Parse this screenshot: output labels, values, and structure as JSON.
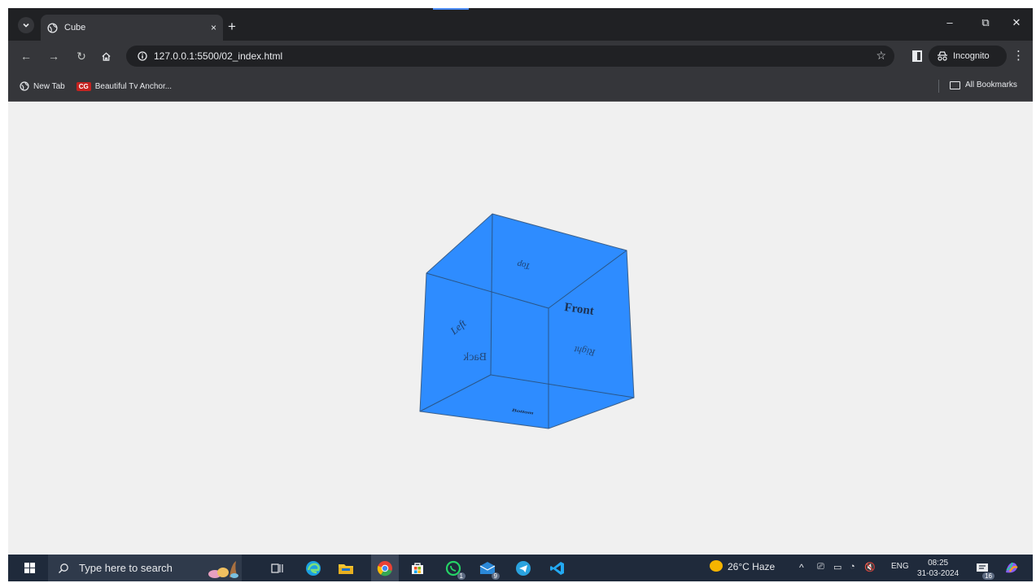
{
  "browser": {
    "tab_title": "Cube",
    "tab_close": "×",
    "new_tab": "+",
    "url": "127.0.0.1:5500/02_index.html",
    "incognito_label": "Incognito",
    "window": {
      "minimize": "–",
      "restore": "⧉",
      "close": "✕"
    }
  },
  "bookmarks": {
    "items": [
      {
        "label": "New Tab"
      },
      {
        "label": "Beautiful Tv Anchor...",
        "badge": "CG"
      }
    ],
    "all_label": "All Bookmarks"
  },
  "cube": {
    "color": "#2e8cff",
    "faces": {
      "front": "Front",
      "back": "Back",
      "left": "Left",
      "right": "Right",
      "top": "Top",
      "bottom": "Bottom"
    }
  },
  "taskbar": {
    "search_placeholder": "Type here to search",
    "whatsapp_badge": "1",
    "mail_badge": "9",
    "weather": "26°C  Haze",
    "language": "ENG",
    "time": "08:25",
    "date": "31-03-2024",
    "notifications_badge": "16"
  }
}
